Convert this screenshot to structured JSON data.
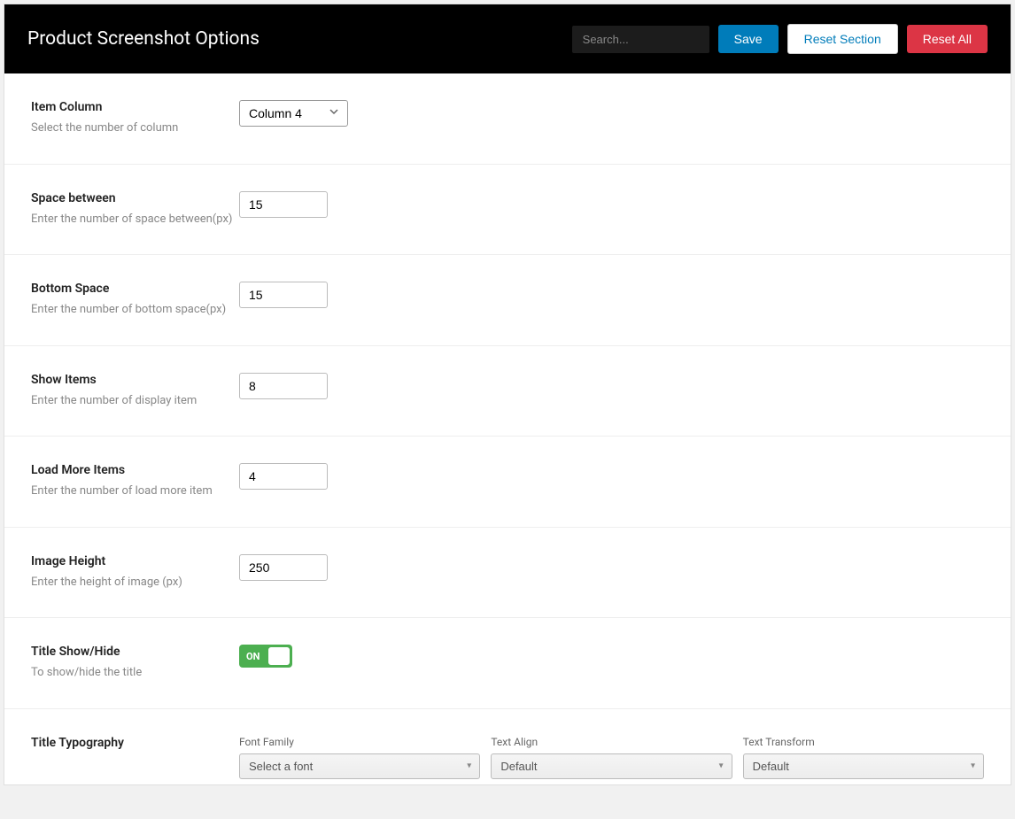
{
  "header": {
    "title": "Product Screenshot Options",
    "search_placeholder": "Search...",
    "save_label": "Save",
    "reset_section_label": "Reset Section",
    "reset_all_label": "Reset All"
  },
  "options": {
    "item_column": {
      "label": "Item Column",
      "desc": "Select the number of column",
      "value": "Column 4"
    },
    "space_between": {
      "label": "Space between",
      "desc": "Enter the number of space between(px)",
      "value": "15"
    },
    "bottom_space": {
      "label": "Bottom Space",
      "desc": "Enter the number of bottom space(px)",
      "value": "15"
    },
    "show_items": {
      "label": "Show Items",
      "desc": "Enter the number of display item",
      "value": "8"
    },
    "load_more_items": {
      "label": "Load More Items",
      "desc": "Enter the number of load more item",
      "value": "4"
    },
    "image_height": {
      "label": "Image Height",
      "desc": "Enter the height of image (px)",
      "value": "250"
    },
    "title_show_hide": {
      "label": "Title Show/Hide",
      "desc": "To show/hide the title",
      "state": "ON"
    },
    "title_typography": {
      "label": "Title Typography",
      "font_family_label": "Font Family",
      "font_family_value": "Select a font",
      "text_align_label": "Text Align",
      "text_align_value": "Default",
      "text_transform_label": "Text Transform",
      "text_transform_value": "Default"
    }
  }
}
